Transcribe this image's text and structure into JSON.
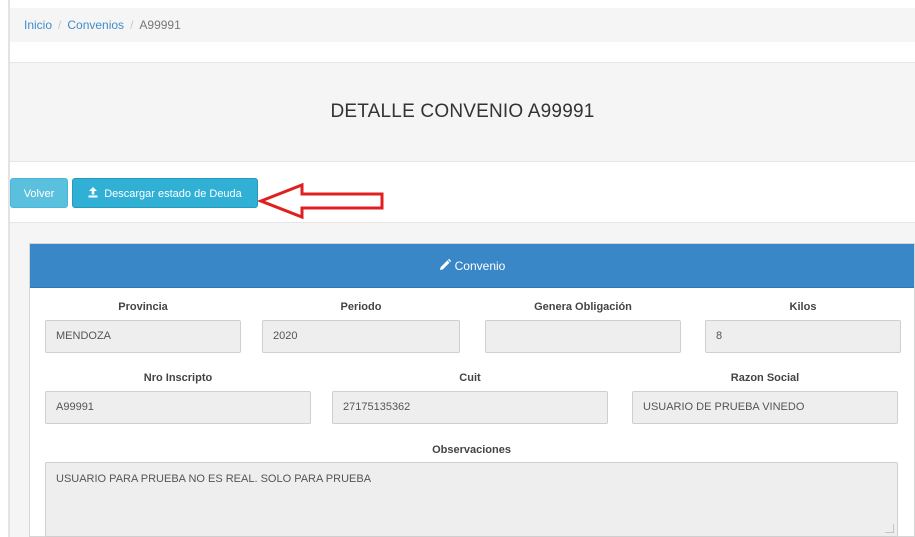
{
  "breadcrumb": {
    "items": [
      "Inicio",
      "Convenios"
    ],
    "separator": "/",
    "current": "A99991"
  },
  "page": {
    "title": "DETALLE CONVENIO A99991"
  },
  "toolbar": {
    "volver_label": "Volver",
    "descargar_label": "Descargar estado de Deuda",
    "descargar_icon": "upload-icon"
  },
  "panel": {
    "title": "Convenio",
    "title_icon": "pencil-icon",
    "heading_color": "#3a87c8"
  },
  "form": {
    "row1": [
      {
        "label": "Provincia",
        "value": "MENDOZA"
      },
      {
        "label": "Periodo",
        "value": "2020"
      },
      {
        "label": "Genera Obligación",
        "value": ""
      },
      {
        "label": "Kilos",
        "value": "8"
      }
    ],
    "row2": [
      {
        "label": "Nro Inscripto",
        "value": "A99991"
      },
      {
        "label": "Cuit",
        "value": "27175135362"
      },
      {
        "label": "Razon Social",
        "value": "USUARIO DE PRUEBA VINEDO"
      }
    ],
    "observaciones": {
      "label": "Observaciones",
      "value": "USUARIO PARA PRUEBA NO ES REAL. SOLO PARA PRUEBA"
    }
  },
  "annotation": {
    "arrow_color": "#e02020"
  }
}
